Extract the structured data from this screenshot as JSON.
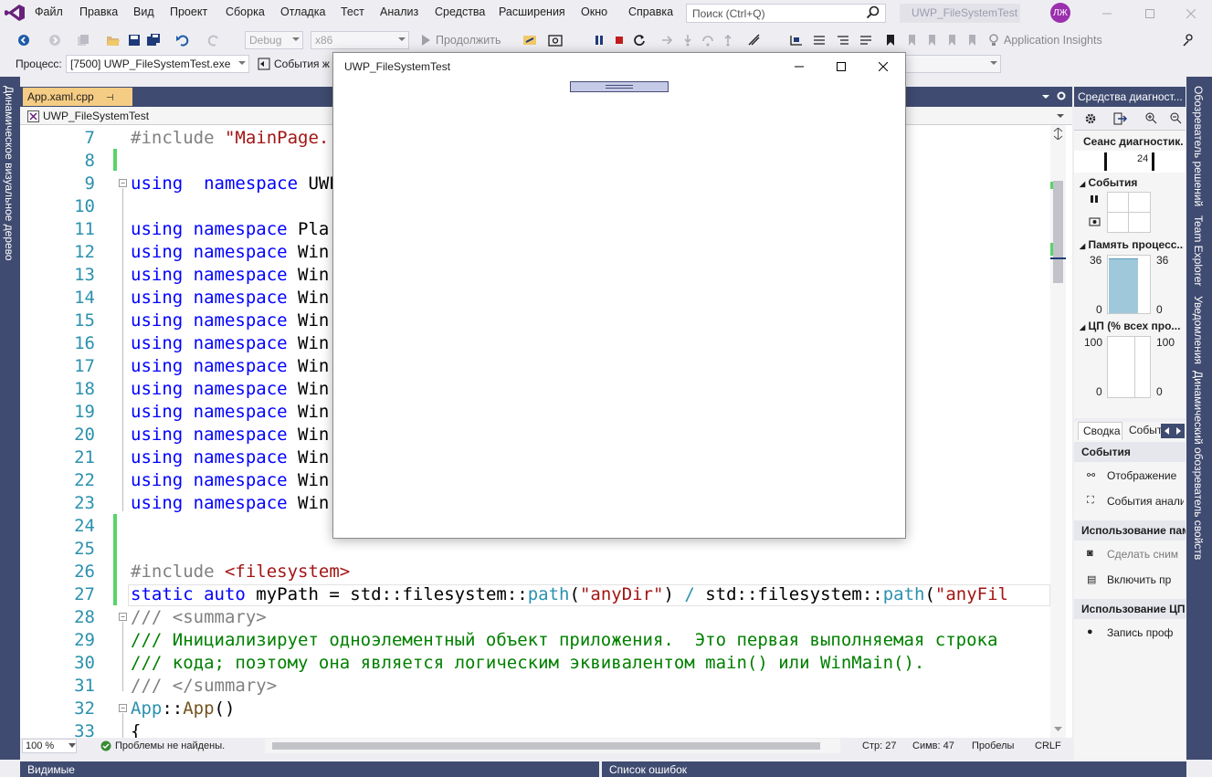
{
  "menu": {
    "items": [
      "Файл",
      "Правка",
      "Вид",
      "Проект",
      "Сборка",
      "Отладка",
      "Тест",
      "Анализ",
      "Средства",
      "Расширения",
      "Окно",
      "Справка"
    ],
    "search_placeholder": "Поиск (Ctrl+Q)",
    "solution_title": "UWP_FileSystemTest",
    "avatar_initials": "ЛЖ"
  },
  "toolbar": {
    "config": "Debug",
    "platform": "x86",
    "continue_label": "Продолжить",
    "insights_label": "Application Insights",
    "process_label": "Процесс:",
    "process_value": "[7500] UWP_FileSystemTest.exe",
    "lifecycle_label": "События ж"
  },
  "left_rail": {
    "label": "Динамическое визуальное дерево"
  },
  "right_rail": {
    "items": [
      "Обозреватель решений",
      "Team Explorer",
      "Уведомления",
      "Динамический обозреватель свойств"
    ]
  },
  "document": {
    "tab_label": "App.xaml.cpp",
    "pin_glyph": "⊣",
    "close_glyph": "✕",
    "nav_scope": "UWP_FileSystemTest"
  },
  "editor": {
    "lines": [
      {
        "n": "7",
        "tokens": [
          [
            "pp",
            "#include "
          ],
          [
            "str",
            "\"MainPage."
          ]
        ]
      },
      {
        "n": "8",
        "tokens": []
      },
      {
        "n": "9",
        "tokens": [
          [
            "kw",
            "using"
          ],
          [
            "",
            "  "
          ],
          [
            "kw",
            "namespace"
          ],
          [
            "",
            " UWP"
          ]
        ]
      },
      {
        "n": "10",
        "tokens": []
      },
      {
        "n": "11",
        "tokens": [
          [
            "kw",
            "using"
          ],
          [
            "",
            " "
          ],
          [
            "kw",
            "namespace"
          ],
          [
            "",
            " Pla"
          ]
        ]
      },
      {
        "n": "12",
        "tokens": [
          [
            "kw",
            "using"
          ],
          [
            "",
            " "
          ],
          [
            "kw",
            "namespace"
          ],
          [
            "",
            " Win"
          ]
        ]
      },
      {
        "n": "13",
        "tokens": [
          [
            "kw",
            "using"
          ],
          [
            "",
            " "
          ],
          [
            "kw",
            "namespace"
          ],
          [
            "",
            " Win"
          ]
        ]
      },
      {
        "n": "14",
        "tokens": [
          [
            "kw",
            "using"
          ],
          [
            "",
            " "
          ],
          [
            "kw",
            "namespace"
          ],
          [
            "",
            " Win"
          ]
        ]
      },
      {
        "n": "15",
        "tokens": [
          [
            "kw",
            "using"
          ],
          [
            "",
            " "
          ],
          [
            "kw",
            "namespace"
          ],
          [
            "",
            " Win"
          ]
        ]
      },
      {
        "n": "16",
        "tokens": [
          [
            "kw",
            "using"
          ],
          [
            "",
            " "
          ],
          [
            "kw",
            "namespace"
          ],
          [
            "",
            " Win"
          ]
        ]
      },
      {
        "n": "17",
        "tokens": [
          [
            "kw",
            "using"
          ],
          [
            "",
            " "
          ],
          [
            "kw",
            "namespace"
          ],
          [
            "",
            " Win"
          ]
        ]
      },
      {
        "n": "18",
        "tokens": [
          [
            "kw",
            "using"
          ],
          [
            "",
            " "
          ],
          [
            "kw",
            "namespace"
          ],
          [
            "",
            " Win"
          ]
        ]
      },
      {
        "n": "19",
        "tokens": [
          [
            "kw",
            "using"
          ],
          [
            "",
            " "
          ],
          [
            "kw",
            "namespace"
          ],
          [
            "",
            " Win"
          ]
        ]
      },
      {
        "n": "20",
        "tokens": [
          [
            "kw",
            "using"
          ],
          [
            "",
            " "
          ],
          [
            "kw",
            "namespace"
          ],
          [
            "",
            " Win"
          ]
        ]
      },
      {
        "n": "21",
        "tokens": [
          [
            "kw",
            "using"
          ],
          [
            "",
            " "
          ],
          [
            "kw",
            "namespace"
          ],
          [
            "",
            " Win"
          ]
        ]
      },
      {
        "n": "22",
        "tokens": [
          [
            "kw",
            "using"
          ],
          [
            "",
            " "
          ],
          [
            "kw",
            "namespace"
          ],
          [
            "",
            " Win"
          ]
        ]
      },
      {
        "n": "23",
        "tokens": [
          [
            "kw",
            "using"
          ],
          [
            "",
            " "
          ],
          [
            "kw",
            "namespace"
          ],
          [
            "",
            " Win"
          ]
        ]
      },
      {
        "n": "24",
        "tokens": []
      },
      {
        "n": "25",
        "tokens": []
      },
      {
        "n": "26",
        "tokens": [
          [
            "pp",
            "#include "
          ],
          [
            "str",
            "<filesystem>"
          ]
        ]
      },
      {
        "n": "27",
        "tokens": [
          [
            "kw",
            "static"
          ],
          [
            "",
            " "
          ],
          [
            "kw",
            "auto"
          ],
          [
            "",
            " myPath = std::filesystem::"
          ],
          [
            "ty",
            "path"
          ],
          [
            "",
            "("
          ],
          [
            "str",
            "\"anyDir\""
          ],
          [
            "",
            ") "
          ],
          [
            "ty",
            "/"
          ],
          [
            "",
            " std::filesystem::"
          ],
          [
            "ty",
            "path"
          ],
          [
            "",
            "("
          ],
          [
            "str",
            "\"anyFil"
          ]
        ]
      },
      {
        "n": "28",
        "tokens": [
          [
            "cmg",
            "/// "
          ],
          [
            "cmg",
            "<summary>"
          ]
        ]
      },
      {
        "n": "29",
        "tokens": [
          [
            "cm",
            "/// Инициализирует одноэлементный объект приложения.  Это первая выполняемая строка"
          ]
        ]
      },
      {
        "n": "30",
        "tokens": [
          [
            "cm",
            "/// кода; поэтому она является логическим эквивалентом main() или WinMain()."
          ]
        ]
      },
      {
        "n": "31",
        "tokens": [
          [
            "cmg",
            "/// "
          ],
          [
            "cmg",
            "</summary>"
          ]
        ]
      },
      {
        "n": "32",
        "tokens": [
          [
            "ty",
            "App"
          ],
          [
            "",
            "::"
          ],
          [
            "fn",
            "App"
          ],
          [
            "",
            "()"
          ]
        ]
      },
      {
        "n": "33",
        "tokens": [
          [
            "",
            "{"
          ]
        ]
      }
    ]
  },
  "status": {
    "zoom": "100 %",
    "issues": "Проблемы не найдены.",
    "line": "Стр: 27",
    "col": "Симв: 47",
    "spaces": "Пробелы",
    "eol": "CRLF"
  },
  "bottom": {
    "left_tab": "Видимые",
    "right_tab": "Список ошибок"
  },
  "diagnostics": {
    "title": "Средства диагност...",
    "session": "Сеанс диагностик...",
    "timeline_value": "24",
    "events_label": "События",
    "memory_label": "Память процесс...",
    "memory_max": "36",
    "memory_min": "0",
    "cpu_label": "ЦП (% всех про...",
    "cpu_max": "100",
    "cpu_min": "0",
    "memory_fill_fraction": 0.95,
    "tabs": [
      "Сводка",
      "Событ"
    ],
    "sections": [
      {
        "header": "События",
        "items": [
          "Отображение",
          "События анализ"
        ]
      },
      {
        "header": "Использование пам",
        "items": [
          "Сделать сним",
          "Включить пр"
        ]
      },
      {
        "header": "Использование ЦП",
        "items": [
          "Запись проф"
        ]
      }
    ]
  },
  "app_window": {
    "title": "UWP_FileSystemTest"
  }
}
